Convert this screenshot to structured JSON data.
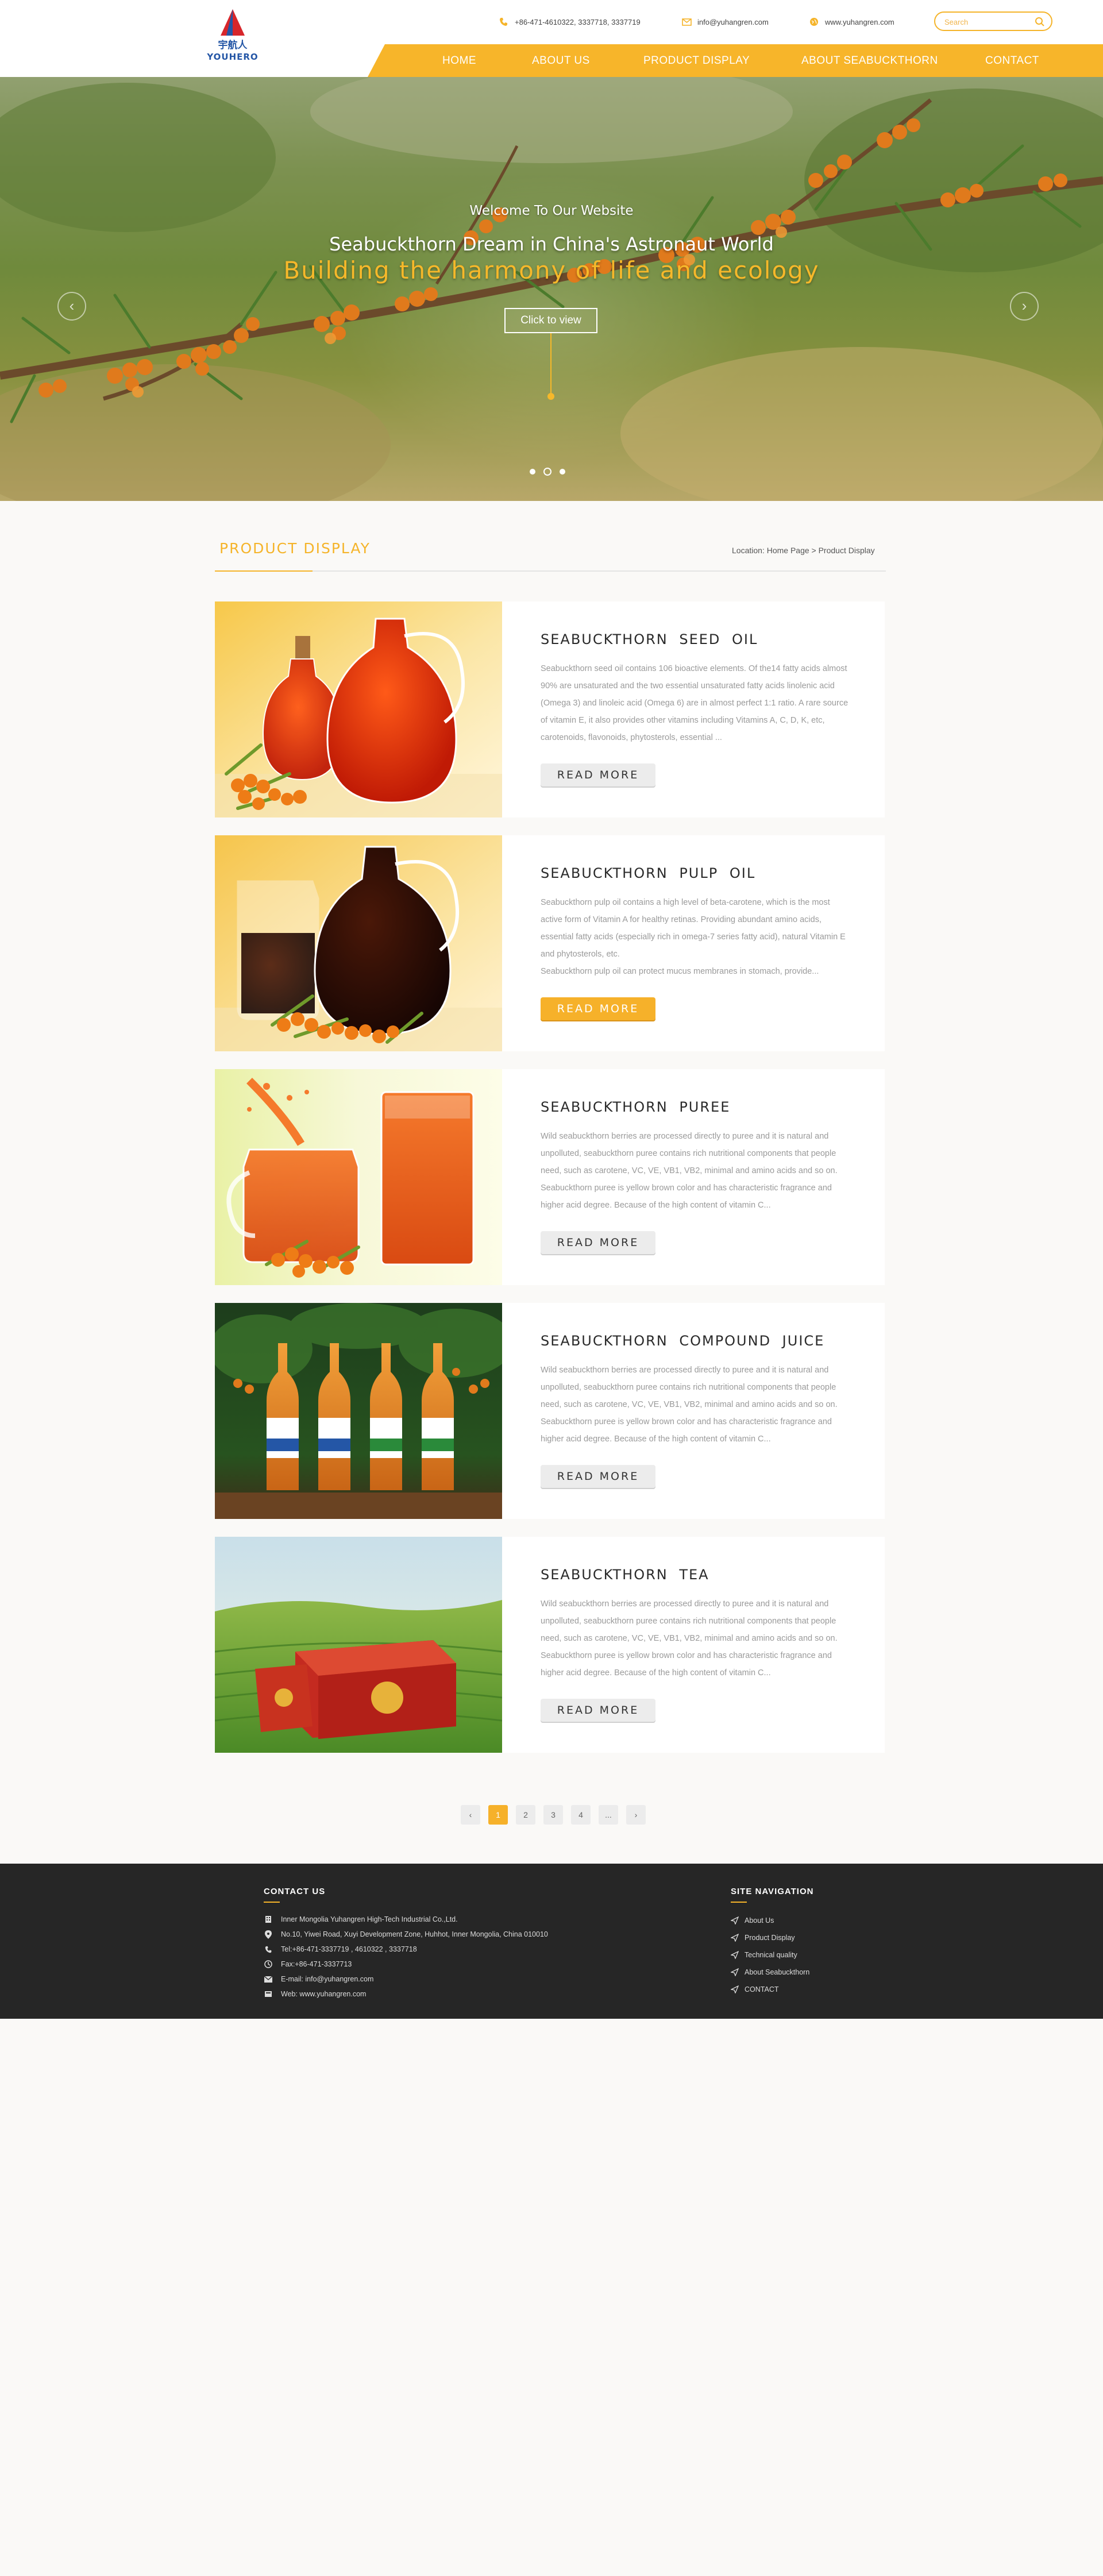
{
  "brand": {
    "logo_text": "YOUHERO",
    "accent_color": "#f5b42a"
  },
  "topbar": {
    "phone": "+86-471-4610322,   3337718,   3337719",
    "email": "info@yuhangren.com",
    "website": "www.yuhangren.com",
    "search_placeholder": "Search"
  },
  "nav": {
    "items": [
      {
        "label": "HOME"
      },
      {
        "label": "ABOUT US"
      },
      {
        "label": "PRODUCT DISPLAY"
      },
      {
        "label": "ABOUT SEABUCKTHORN"
      },
      {
        "label": "CONTACT"
      }
    ]
  },
  "hero": {
    "welcome": "Welcome To Our Website",
    "title": "Seabuckthorn Dream in China's Astronaut World",
    "subtitle": "Building the harmony of life and ecology",
    "cta": "Click to view",
    "prev": "‹",
    "next": "›"
  },
  "section": {
    "title": "PRODUCT DISPLAY",
    "breadcrumb": "Location: Home Page > Product Display"
  },
  "products": [
    {
      "title": "SEABUCKTHORN  SEED  OIL",
      "desc": [
        "Seabuckthorn seed oil contains 106 bioactive elements. Of the14 fatty acids almost 90% are unsaturated and the two essential unsaturated fatty acids linolenic acid (Omega 3) and linoleic acid (Omega 6) are in almost perfect 1:1 ratio. A rare source of vitamin E, it also provides other vitamins including Vitamins A, C, D, K, etc, carotenoids, flavonoids, phytosterols, essential ..."
      ],
      "button": "READ MORE"
    },
    {
      "title": "SEABUCKTHORN  PULP  OIL",
      "desc": [
        "Seabuckthorn pulp oil contains a high level of beta-carotene, which is the most active form of Vitamin A for healthy retinas. Providing abundant amino acids, essential fatty acids (especially rich in omega-7 series fatty acid), natural Vitamin E and phytosterols, etc.",
        "Seabuckthorn pulp oil can protect mucus membranes in stomach, provide..."
      ],
      "button": "READ MORE"
    },
    {
      "title": "SEABUCKTHORN  PUREE",
      "desc": [
        "Wild seabuckthorn berries are processed directly to puree and it is natural and unpolluted, seabuckthorn puree contains rich nutritional components that people need, such as carotene, VC, VE, VB1, VB2, minimal and amino acids and so on. Seabuckthorn puree is yellow brown color and has characteristic fragrance and higher acid degree. Because of the high content of vitamin C..."
      ],
      "button": "READ MORE"
    },
    {
      "title": "SEABUCKTHORN  COMPOUND  JUICE",
      "desc": [
        "Wild seabuckthorn berries are processed directly to puree and it is natural and unpolluted, seabuckthorn puree contains rich nutritional components that people need, such as carotene, VC, VE, VB1, VB2, minimal and amino acids and so on. Seabuckthorn puree is yellow brown color and has characteristic fragrance and higher acid degree. Because of the high content of vitamin C..."
      ],
      "button": "READ MORE"
    },
    {
      "title": "SEABUCKTHORN  TEA",
      "desc": [
        "Wild seabuckthorn berries are processed directly to puree and it is natural and unpolluted, seabuckthorn puree contains rich nutritional components that people need, such as carotene, VC, VE, VB1, VB2, minimal and amino acids and so on. Seabuckthorn puree is yellow brown color and has characteristic fragrance and higher acid degree. Because of the high content of vitamin C..."
      ],
      "button": "READ MORE"
    }
  ],
  "pagination": {
    "prev": "‹",
    "pages": [
      "1",
      "2",
      "3",
      "4",
      "..."
    ],
    "next": "›",
    "current": "1"
  },
  "footer": {
    "contact_title": "CONTACT US",
    "contact": [
      {
        "icon": "building-icon",
        "text": "Inner Mongolia Yuhangren High-Tech Industrial Co.,Ltd."
      },
      {
        "icon": "location-pin-icon",
        "text": "No.10, Yiwei Road, Xuyi Development Zone, Huhhot, Inner Mongolia, China 010010"
      },
      {
        "icon": "phone-icon",
        "text": "Tel:+86-471-3337719 , 4610322 , 3337718"
      },
      {
        "icon": "fax-icon",
        "text": "Fax:+86-471-3337713"
      },
      {
        "icon": "mail-icon",
        "text": "E-mail: info@yuhangren.com"
      },
      {
        "icon": "web-icon",
        "text": "Web: www.yuhangren.com"
      }
    ],
    "nav_title": "SITE NAVIGATION",
    "nav": [
      {
        "label": "About Us"
      },
      {
        "label": "Product Display"
      },
      {
        "label": "Technical quality"
      },
      {
        "label": "About Seabuckthorn"
      },
      {
        "label": "CONTACT"
      }
    ]
  }
}
